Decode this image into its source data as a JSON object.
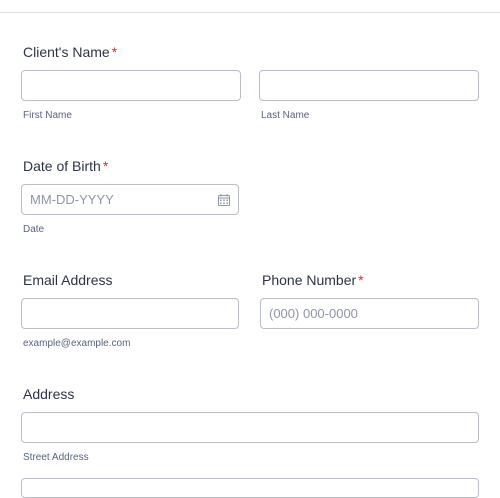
{
  "clients_name": {
    "label": "Client's Name",
    "required_mark": "*",
    "first_name": {
      "value": "",
      "sublabel": "First Name"
    },
    "last_name": {
      "value": "",
      "sublabel": "Last Name"
    }
  },
  "date_of_birth": {
    "label": "Date of Birth",
    "required_mark": "*",
    "placeholder": "MM-DD-YYYY",
    "sublabel": "Date",
    "icon": "calendar-icon"
  },
  "email": {
    "label": "Email Address",
    "value": "",
    "sublabel": "example@example.com"
  },
  "phone": {
    "label": "Phone Number",
    "required_mark": "*",
    "placeholder": "(000) 000-0000"
  },
  "address": {
    "label": "Address",
    "street": {
      "value": "",
      "sublabel": "Street Address"
    }
  },
  "colors": {
    "required": "#e02c2c",
    "field_border": "#b8bdc9",
    "label_text": "#2c3345",
    "sublabel_text": "#57647e"
  }
}
